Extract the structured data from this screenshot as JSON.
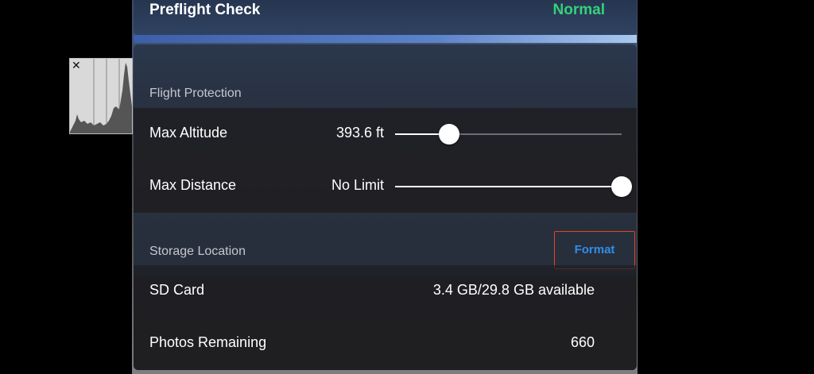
{
  "histogram": {
    "close_glyph": "✕"
  },
  "preflight": {
    "label": "Preflight Check",
    "status": "Normal",
    "status_color": "#35d17a"
  },
  "flight_protection": {
    "title": "Flight Protection",
    "max_altitude": {
      "label": "Max Altitude",
      "value": "393.6 ft",
      "slider_fraction": 0.24
    },
    "max_distance": {
      "label": "Max Distance",
      "value": "No Limit",
      "slider_fraction": 1.0
    }
  },
  "storage": {
    "title": "Storage Location",
    "format_label": "Format",
    "sd_card": {
      "label": "SD Card",
      "value": "3.4 GB/29.8 GB available"
    },
    "photos_remaining": {
      "label": "Photos Remaining",
      "value": "660"
    }
  },
  "colors": {
    "accent_blue": "#2f8ee8",
    "highlight_red": "#e2442b"
  }
}
